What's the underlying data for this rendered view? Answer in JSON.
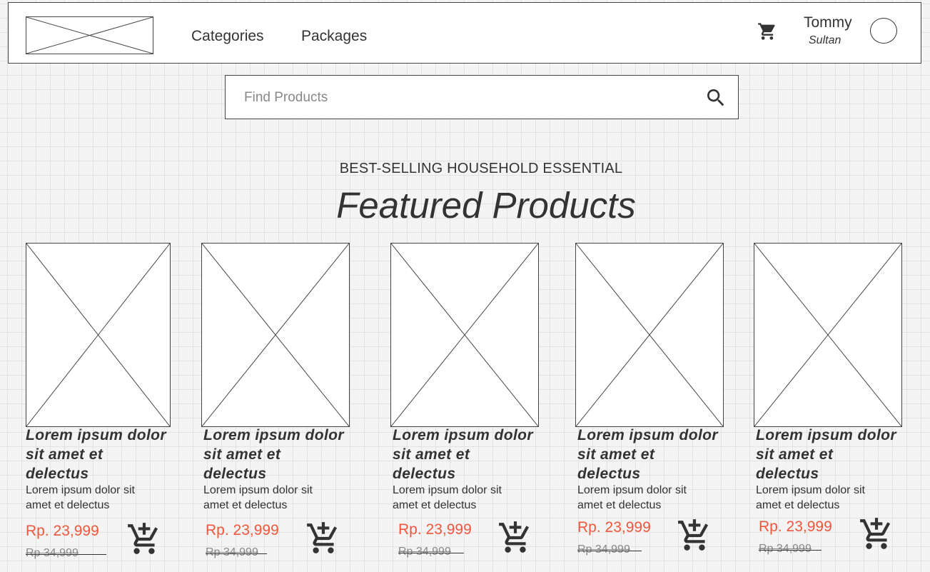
{
  "header": {
    "logo": "logo placeholder",
    "nav": {
      "categories": "Categories",
      "packages": "Packages"
    },
    "cart_icon": "cart-icon",
    "user": {
      "name": "Tommy",
      "role": "Sultan"
    }
  },
  "search": {
    "placeholder": "Find Products",
    "value": "",
    "icon": "search-icon"
  },
  "section": {
    "subtitle": "BEST-SELLING HOUSEHOLD ESSENTIAL",
    "title": "Featured Products"
  },
  "products": [
    {
      "name": "Lorem ipsum dolor sit amet et delectus",
      "description": "Lorem ipsum dolor sit amet et delectus",
      "price": "Rp. 23,999",
      "old_price": "Rp 34,999"
    },
    {
      "name": "Lorem ipsum dolor sit amet et delectus",
      "description": "Lorem ipsum dolor sit amet et delectus",
      "price": "Rp. 23,999",
      "old_price": "Rp 34,999"
    },
    {
      "name": "Lorem ipsum dolor sit amet et delectus",
      "description": "Lorem ipsum dolor sit amet et delectus",
      "price": "Rp. 23,999",
      "old_price": "Rp 34,999"
    },
    {
      "name": "Lorem ipsum dolor sit amet et delectus",
      "description": "Lorem ipsum dolor sit amet et delectus",
      "price": "Rp. 23,999",
      "old_price": "Rp 34,999"
    },
    {
      "name": "Lorem ipsum dolor sit amet et delectus",
      "description": "Lorem ipsum dolor sit amet et delectus",
      "price": "Rp. 23,999",
      "old_price": "Rp 34,999"
    }
  ],
  "colors": {
    "price": "#f0563b",
    "text": "#333333",
    "grid": "#e2e2e2"
  }
}
